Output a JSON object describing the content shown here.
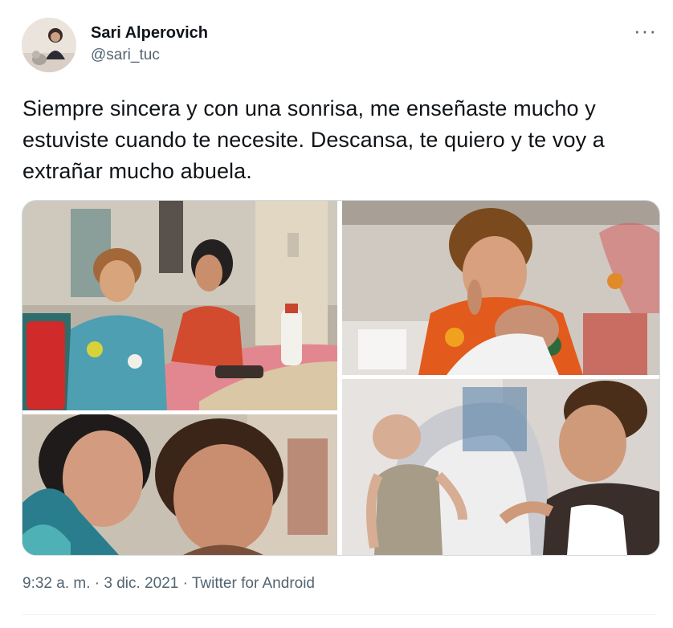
{
  "author": {
    "name": "Sari Alperovich",
    "handle": "@sari_tuc",
    "avatar_icon": "user-avatar"
  },
  "menu": {
    "more_label": "···",
    "icon": "more-horizontal-icon"
  },
  "tweet": {
    "text": "Siempre sincera y con una sonrisa, me enseñaste mucho y estuviste cuando te necesite. Descansa, te quiero y te voy a extrañar mucho abuela."
  },
  "media": {
    "count": 4
  },
  "meta": {
    "timestamp": "9:32 a. m. · 3 dic. 2021 · Twitter for Android"
  },
  "colors": {
    "text": "#0f1419",
    "secondary": "#536471",
    "border": "#cfd9de"
  }
}
